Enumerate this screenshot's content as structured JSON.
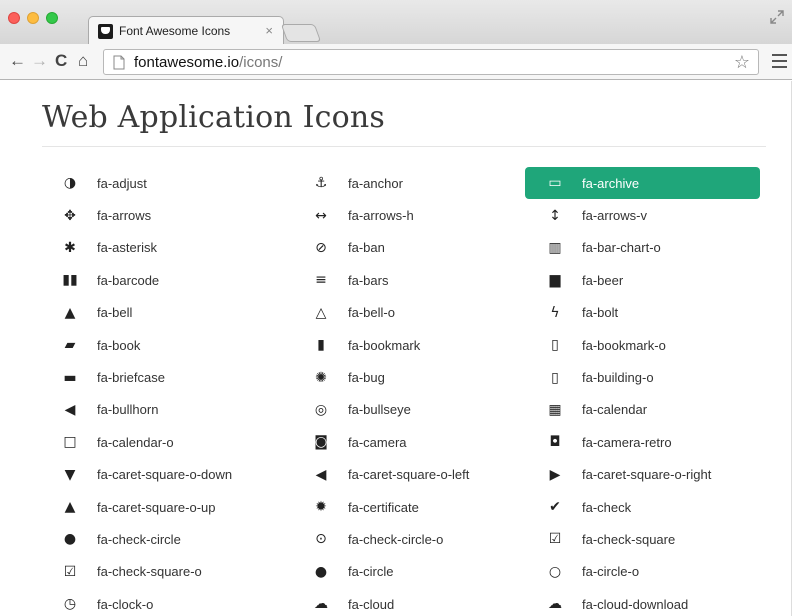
{
  "browser": {
    "tab_title": "Font Awesome Icons",
    "tab_close": "×",
    "url_host": "fontawesome.io",
    "url_path": "/icons/",
    "back_glyph": "←",
    "forward_glyph": "→",
    "reload_glyph": "C",
    "home_glyph": "⌂",
    "star_glyph": "☆"
  },
  "page": {
    "title": "Web Application Icons",
    "accent": "#1fa67a"
  },
  "icons": [
    {
      "label": "fa-adjust",
      "glyph": "◑"
    },
    {
      "label": "fa-anchor",
      "glyph": "⚓"
    },
    {
      "label": "fa-archive",
      "glyph": "▭",
      "active": true
    },
    {
      "label": "fa-arrows",
      "glyph": "✥"
    },
    {
      "label": "fa-arrows-h",
      "glyph": "↔"
    },
    {
      "label": "fa-arrows-v",
      "glyph": "↕"
    },
    {
      "label": "fa-asterisk",
      "glyph": "✱"
    },
    {
      "label": "fa-ban",
      "glyph": "⊘"
    },
    {
      "label": "fa-bar-chart-o",
      "glyph": "▥"
    },
    {
      "label": "fa-barcode",
      "glyph": "▮▮"
    },
    {
      "label": "fa-bars",
      "glyph": "≡"
    },
    {
      "label": "fa-beer",
      "glyph": "▆"
    },
    {
      "label": "fa-bell",
      "glyph": "▲"
    },
    {
      "label": "fa-bell-o",
      "glyph": "△"
    },
    {
      "label": "fa-bolt",
      "glyph": "ϟ"
    },
    {
      "label": "fa-book",
      "glyph": "▰"
    },
    {
      "label": "fa-bookmark",
      "glyph": "▮"
    },
    {
      "label": "fa-bookmark-o",
      "glyph": "▯"
    },
    {
      "label": "fa-briefcase",
      "glyph": "▬"
    },
    {
      "label": "fa-bug",
      "glyph": "✺"
    },
    {
      "label": "fa-building-o",
      "glyph": "▯"
    },
    {
      "label": "fa-bullhorn",
      "glyph": "◀"
    },
    {
      "label": "fa-bullseye",
      "glyph": "◎"
    },
    {
      "label": "fa-calendar",
      "glyph": "▦"
    },
    {
      "label": "fa-calendar-o",
      "glyph": "□"
    },
    {
      "label": "fa-camera",
      "glyph": "◙"
    },
    {
      "label": "fa-camera-retro",
      "glyph": "◘"
    },
    {
      "label": "fa-caret-square-o-down",
      "glyph": "▼"
    },
    {
      "label": "fa-caret-square-o-left",
      "glyph": "◀"
    },
    {
      "label": "fa-caret-square-o-right",
      "glyph": "▶"
    },
    {
      "label": "fa-caret-square-o-up",
      "glyph": "▲"
    },
    {
      "label": "fa-certificate",
      "glyph": "✹"
    },
    {
      "label": "fa-check",
      "glyph": "✔"
    },
    {
      "label": "fa-check-circle",
      "glyph": "●"
    },
    {
      "label": "fa-check-circle-o",
      "glyph": "⊙"
    },
    {
      "label": "fa-check-square",
      "glyph": "☑"
    },
    {
      "label": "fa-check-square-o",
      "glyph": "☑"
    },
    {
      "label": "fa-circle",
      "glyph": "●"
    },
    {
      "label": "fa-circle-o",
      "glyph": "○"
    },
    {
      "label": "fa-clock-o",
      "glyph": "◷"
    },
    {
      "label": "fa-cloud",
      "glyph": "☁"
    },
    {
      "label": "fa-cloud-download",
      "glyph": "☁"
    }
  ]
}
